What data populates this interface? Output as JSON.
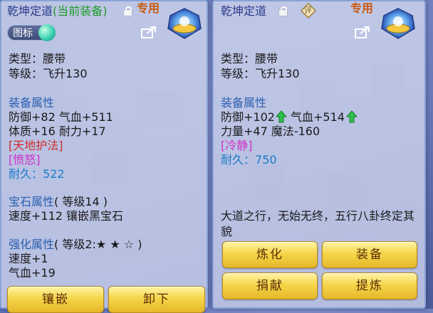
{
  "left": {
    "name": "乾坤定道",
    "equipped_tag": "(当前装备)",
    "special_tag": "专用",
    "tag_button_label": "图标",
    "type_line": "类型：腰带",
    "level_line": "等级：飞升130",
    "equip_attr_title": "装备属性",
    "attr_line_1": "防御+82 气血+511",
    "attr_line_2": "体质+16 耐力+17",
    "special_skill": "[天地护法]",
    "special_effect": "[愤怒]",
    "durability_label": "耐久：",
    "durability_value": "522",
    "gem_title": "宝石属性",
    "gem_level": "( 等级14 )",
    "gem_line": "速度+112 镶嵌黑宝石",
    "enhance_title": "强化属性",
    "enhance_level": "( 等级2:★ ★ ☆ )",
    "enhance_line_1": "速度+1",
    "enhance_line_2": "气血+19",
    "button_inlay": "镶嵌",
    "button_unequip": "卸下"
  },
  "right": {
    "name": "乾坤定道",
    "badge": "评",
    "special_tag": "专用",
    "type_line": "类型：腰带",
    "level_line": "等级：飞升130",
    "equip_attr_title": "装备属性",
    "attr_line_1a": "防御+102",
    "attr_line_1b": "气血+514",
    "attr_line_2": "力量+47 魔法-160",
    "special_effect": "[冷静]",
    "durability_label": "耐久：",
    "durability_value": "750",
    "description": "大道之行，无始无终，五行八卦终定其貌",
    "button_refine": "炼化",
    "button_equip": "装备",
    "button_donate": "捐献",
    "button_extract": "提炼"
  },
  "colors": {
    "accent_blue": "#2a5fb0",
    "equipped_green": "#1f9a2a",
    "special_orange": "#c85a10",
    "skill_red": "#d02a2a",
    "effect_magenta": "#d030c8",
    "upgrade_green": "#2fc04a",
    "button_gold": "#f5d64a"
  }
}
